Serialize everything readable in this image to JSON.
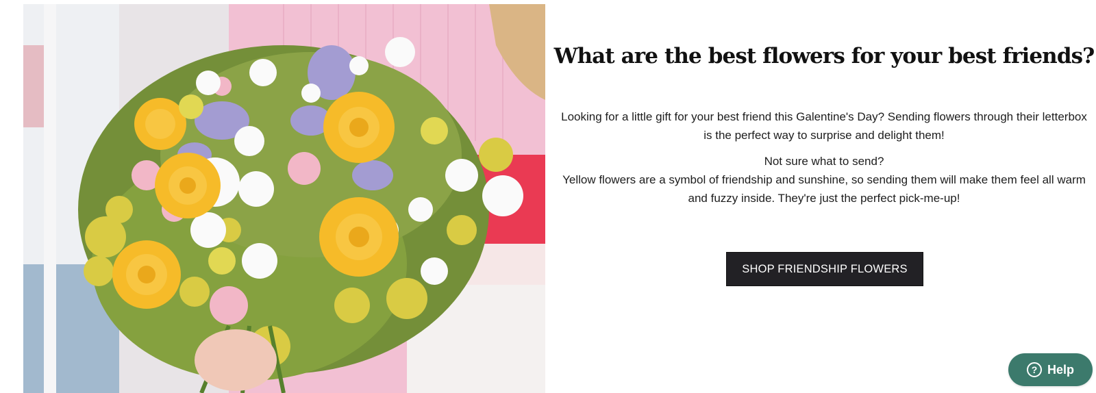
{
  "section": {
    "heading": "What are the best flowers for your best friends?",
    "paragraph_1": "Looking for a little gift for your best friend this Galentine's Day? Sending flowers through their letterbox is the perfect way to surprise and delight them!",
    "paragraph_2_line_1": "Not sure what to send?",
    "paragraph_2_line_2": "Yellow flowers are a symbol of friendship and sunshine, so sending them will make them feel all warm and fuzzy inside. They're just the perfect pick-me-up!",
    "button_label": "SHOP FRIENDSHIP FLOWERS"
  },
  "help_widget": {
    "icon": "question-circle-icon",
    "label": "Help"
  },
  "photo": {
    "icon": "flower-bouquet-photo"
  },
  "colors": {
    "button_bg": "#222125",
    "help_bg": "#3c7a6c",
    "heading_text": "#111111"
  }
}
